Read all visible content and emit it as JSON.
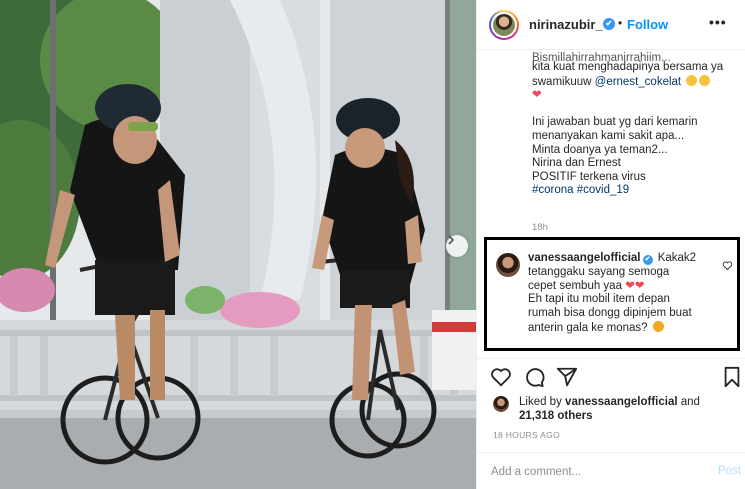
{
  "header": {
    "username": "nirinazubir_",
    "verified_mark": "✔",
    "separator": "•",
    "follow_label": "Follow",
    "more_label": "•••"
  },
  "caption": {
    "lines": [
      "Bismillahirrahmanirrahiim...",
      "kita kuat menghadapinya bersama ya",
      "swamikuuw",
      "",
      "",
      "Ini jawaban buat yg dari kemarin",
      "menanyakan kami sakit apa...",
      "Minta doanya ya teman2...",
      "Nirina dan Ernest",
      "POSITIF terkena virus"
    ],
    "mention": "@ernest_cokelat",
    "heart": "❤",
    "hashtags": "#corona #covid_19",
    "time": "18h"
  },
  "comment": {
    "username": "vanessaangelofficial",
    "verified_mark": "✔",
    "lines": [
      "Kakak2",
      "tetanggaku sayang semoga",
      "cepet sembuh yaa",
      "Eh tapi itu mobil item depan",
      "rumah bisa dongg dipinjem buat",
      "anterin gala ke monas?"
    ],
    "hearts": "❤❤"
  },
  "likes": {
    "prefix": "Liked by",
    "user": "vanessaangelofficial",
    "and": "and",
    "others": "21,318 others"
  },
  "post_time": "18 HOURS AGO",
  "add_comment": {
    "placeholder": "Add a comment...",
    "post_label": "Post"
  },
  "colors": {
    "link_blue": "#0095f6",
    "mention_blue": "#00376b",
    "heart_red": "#ed4956",
    "muted_gray": "#8e8e8e",
    "verified_blue": "#3897f0"
  },
  "icons": {
    "like": "heart-outline-icon",
    "comment": "comment-bubble-icon",
    "share": "paper-plane-icon",
    "save": "bookmark-icon",
    "next": "chevron-right-icon"
  }
}
